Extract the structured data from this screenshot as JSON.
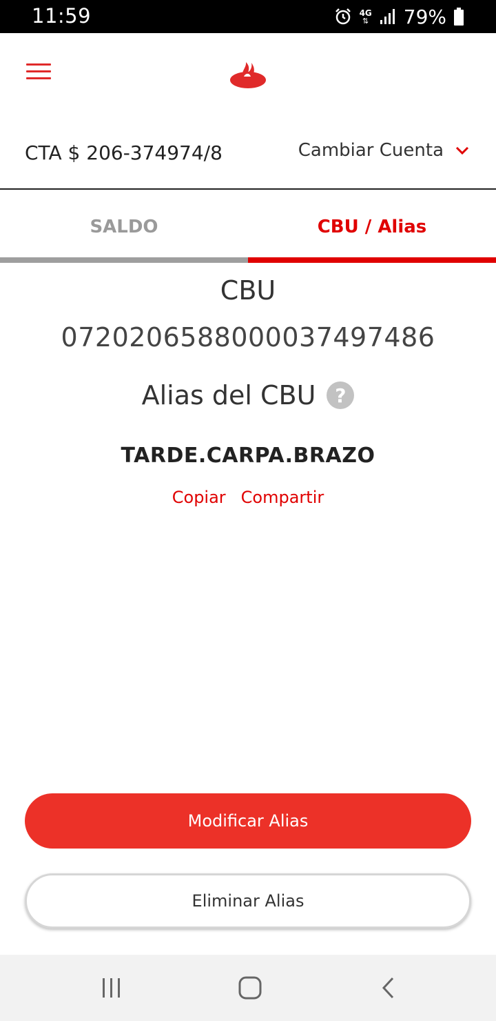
{
  "status_bar": {
    "time": "11:59",
    "network": "4G",
    "battery": "79%",
    "icons": [
      "alarm-icon",
      "network-4g-icon",
      "signal-icon",
      "battery-icon"
    ]
  },
  "header": {
    "menu_icon": "hamburger-menu-icon",
    "logo": "santander-flame-logo",
    "brand_color": "#e00000"
  },
  "account": {
    "number": "CTA $ 206-374974/8",
    "change_label": "Cambiar Cuenta",
    "change_icon": "chevron-down-icon"
  },
  "tabs": [
    {
      "label": "SALDO",
      "active": false
    },
    {
      "label": "CBU / Alias",
      "active": true
    }
  ],
  "cbu": {
    "title": "CBU",
    "number": "0720206588000037497486",
    "alias_title": "Alias del CBU",
    "help_icon": "?",
    "alias_value": "TARDE.CARPA.BRAZO",
    "copy_label": "Copiar",
    "share_label": "Compartir"
  },
  "actions": {
    "modify_label": "Modificar Alias",
    "delete_label": "Eliminar Alias",
    "primary_color": "#ec3128"
  },
  "nav_bar": {
    "icons": [
      "recent-apps-icon",
      "home-icon",
      "back-icon"
    ]
  }
}
